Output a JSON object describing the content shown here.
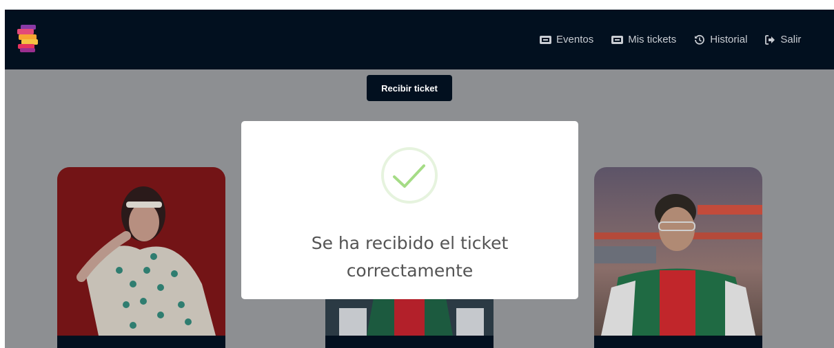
{
  "navbar": {
    "logo_icon": "s-logo-icon",
    "items": [
      {
        "label": "Eventos",
        "icon": "ticket-icon"
      },
      {
        "label": "Mis tickets",
        "icon": "ticket-icon"
      },
      {
        "label": "Historial",
        "icon": "history-icon"
      },
      {
        "label": "Salir",
        "icon": "logout-icon"
      }
    ]
  },
  "main": {
    "receive_button_label": "Recibir ticket",
    "cards": [
      {
        "image": "artist-photo-woman-red-background"
      },
      {
        "image": "artist-photo-red-green-jacket"
      },
      {
        "image": "artist-photo-man-glasses"
      }
    ]
  },
  "modal": {
    "icon": "success-check-icon",
    "message_line1": "Se ha recibido el ticket",
    "message_line2": "correctamente"
  },
  "colors": {
    "navbar_bg": "#02101f",
    "overlay_bg": "#8d8f92",
    "success_green": "#a5dc86",
    "modal_text": "#545454"
  }
}
